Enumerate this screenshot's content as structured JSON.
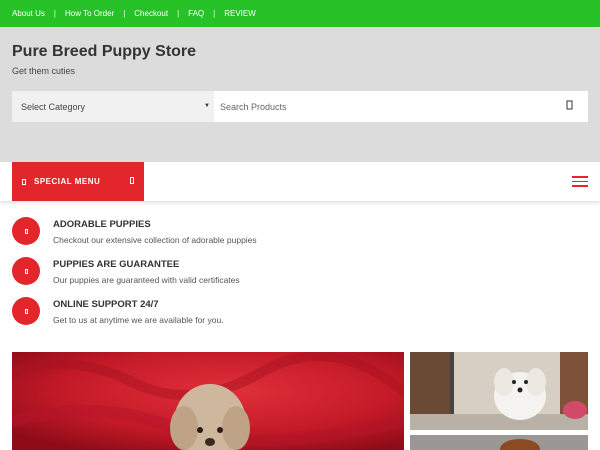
{
  "topnav": {
    "items": [
      "About Us",
      "How To Order",
      "Checkout",
      "FAQ",
      "REVIEW"
    ]
  },
  "site": {
    "title": "Pure Breed Puppy Store",
    "tagline": "Get them cuties"
  },
  "search": {
    "category_value": "Select Category",
    "placeholder": "Search Products"
  },
  "menu": {
    "special_label": "SPECIAL MENU"
  },
  "features": [
    {
      "title": "ADORABLE PUPPIES",
      "desc": "Checkout our extensive collection of adorable puppies"
    },
    {
      "title": "PUPPIES ARE GUARANTEE",
      "desc": "Our puppies are guaranteed with valid certificates"
    },
    {
      "title": "ONLINE SUPPORT 24/7",
      "desc": "Get to us at anytime we are available for you."
    }
  ],
  "colors": {
    "topbar": "#27c227",
    "accent": "#e3262b",
    "header_bg": "#dcdcdc"
  },
  "icons": {
    "feature": "square-icon",
    "search": "search-icon",
    "menu": "hamburger-menu-icon"
  }
}
